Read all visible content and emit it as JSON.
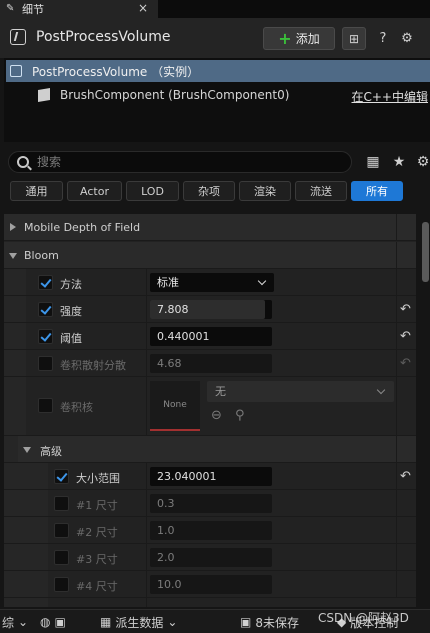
{
  "tab": {
    "title": "细节",
    "close": "×"
  },
  "header": {
    "title": "PostProcessVolume",
    "add_label": "添加"
  },
  "components": {
    "root": "PostProcessVolume （实例）",
    "child": "BrushComponent (BrushComponent0)",
    "edit_link": "在C++中编辑"
  },
  "search": {
    "placeholder": "搜索"
  },
  "filters": [
    "通用",
    "Actor",
    "LOD",
    "杂项",
    "渲染",
    "流送",
    "所有"
  ],
  "categories": {
    "mobile_dof": "Mobile Depth of Field",
    "bloom": "Bloom",
    "advanced": "高级"
  },
  "bloom": {
    "method": {
      "label": "方法",
      "value": "标准"
    },
    "intensity": {
      "label": "强度",
      "value": "7.808",
      "fill": 0.94
    },
    "threshold": {
      "label": "阈值",
      "value": "0.440001"
    },
    "conv_scatter": {
      "label": "卷积散射分散",
      "value": "4.68"
    },
    "conv_kernel": {
      "label": "卷积核",
      "thumb": "None",
      "value": "无"
    }
  },
  "advanced": {
    "size_scale": {
      "label": "大小范围",
      "value": "23.040001"
    },
    "sizes": [
      {
        "label": "#1 尺寸",
        "value": "0.3"
      },
      {
        "label": "#2 尺寸",
        "value": "1.0"
      },
      {
        "label": "#3 尺寸",
        "value": "2.0"
      },
      {
        "label": "#4 尺寸",
        "value": "10.0"
      }
    ]
  },
  "statusbar": {
    "left": "综",
    "derived": "派生数据",
    "unsaved": "8未保存",
    "version": "版本控制"
  },
  "watermark": "CSDN @阿赵3D"
}
